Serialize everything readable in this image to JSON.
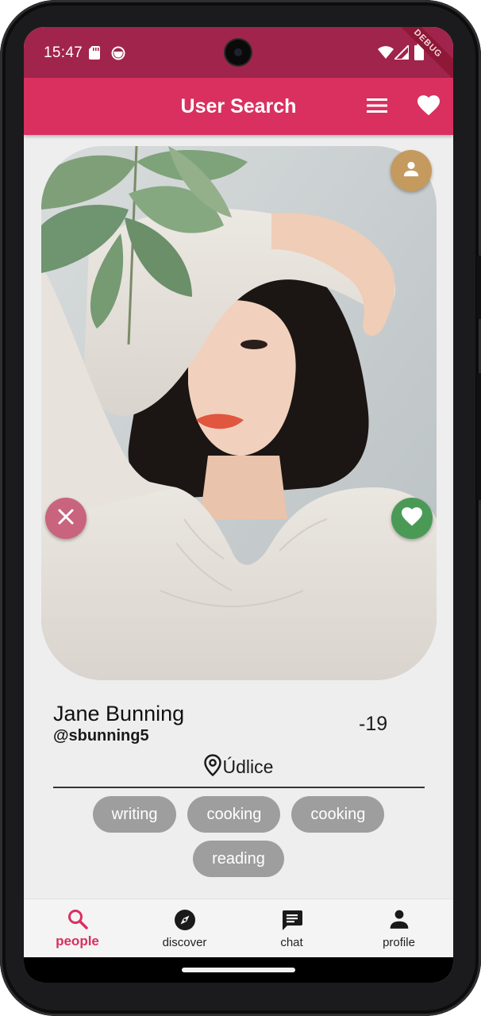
{
  "status_bar": {
    "time": "15:47",
    "debug_label": "DEBUG"
  },
  "app_bar": {
    "title": "User Search",
    "menu_icon": "menu-icon",
    "favorites_icon": "heart-icon"
  },
  "profile": {
    "name": "Jane Bunning",
    "handle": "@sbunning5",
    "age": "-19",
    "location": "Údlice",
    "interests": [
      "writing",
      "cooking",
      "cooking",
      "reading"
    ]
  },
  "actions": {
    "dislike_icon": "close-icon",
    "like_icon": "heart-icon",
    "profile_icon": "person-icon"
  },
  "bottom_nav": {
    "items": [
      {
        "label": "people",
        "icon": "search-icon",
        "active": true
      },
      {
        "label": "discover",
        "icon": "compass-icon",
        "active": false
      },
      {
        "label": "chat",
        "icon": "chat-icon",
        "active": false
      },
      {
        "label": "profile",
        "icon": "person-icon",
        "active": false
      }
    ]
  },
  "colors": {
    "status_bar": "#a1244c",
    "app_bar": "#d9305f",
    "accent": "#d9305f",
    "chip": "#9e9e9e",
    "like": "#4a9a56",
    "dislike": "#c9647f",
    "profile_button": "#c59a5f",
    "background": "#eeeeee"
  }
}
